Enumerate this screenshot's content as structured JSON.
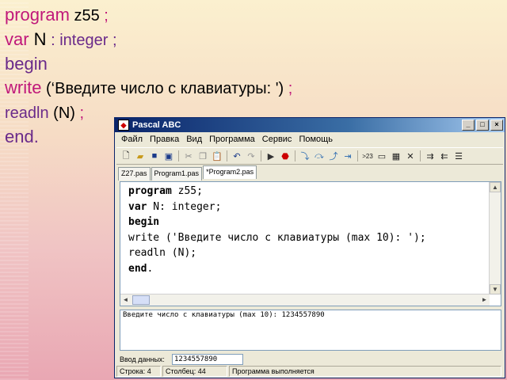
{
  "slide": {
    "line1_kw": "program",
    "line1_rest": " z55",
    "line1_end": " ;",
    "line2_kw": "var",
    "line2_n": " N",
    "line2_rest": " : integer ;",
    "line3": "begin",
    "line4_kw": "write",
    "line4_rest": " (‘Введите число с клавиатуры: ')",
    "line4_end": " ;",
    "line5_kw": "readln",
    "line5_rest": " (N)",
    "line5_end": " ;",
    "line6": "end."
  },
  "window": {
    "title": "Pascal ABC",
    "buttons": {
      "minimize": "_",
      "maximize": "□",
      "close": "×"
    },
    "menu": [
      "Файл",
      "Правка",
      "Вид",
      "Программа",
      "Сервис",
      "Помощь"
    ],
    "tabs": [
      "Z27.pas",
      "Program1.pas",
      "*Program2.pas"
    ],
    "code": {
      "l1_kw": "program",
      "l1_rest": " z55;",
      "l2_kw": "var",
      "l2_rest": " N: integer;",
      "l3_kw": "begin",
      "l4_kw": "write",
      "l4_rest": " ('Введите число с клавиатуры (max 10): ');",
      "l5_kw": "readln",
      "l5_rest": " (N);",
      "l6_kw": "end",
      "l6_rest": "."
    },
    "output_text": "Введите число с клавиатуры (max 10): 1234557890",
    "input_label": "Ввод данных:",
    "input_value": "1234557890",
    "status": {
      "row": "Строка: 4",
      "col": "Столбец: 44",
      "state": "Программа выполняется"
    }
  }
}
